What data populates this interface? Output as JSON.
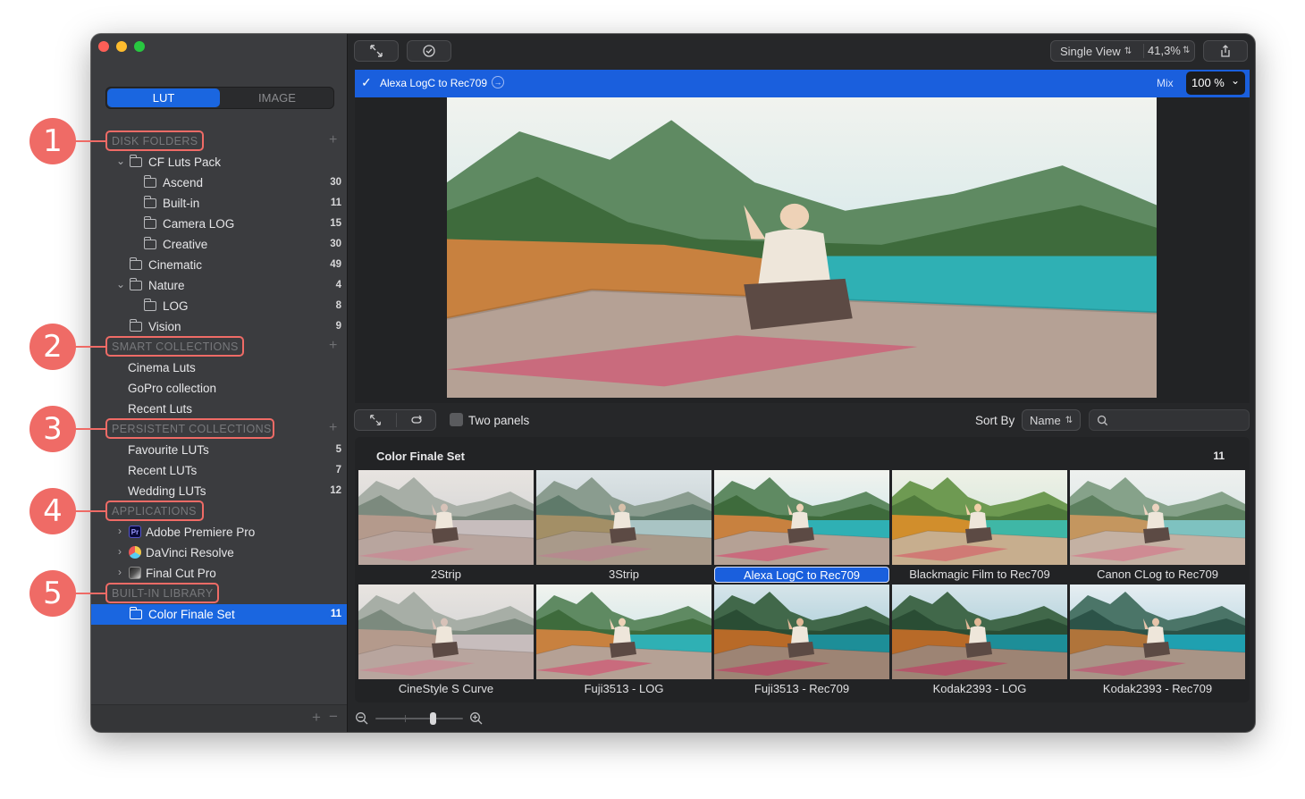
{
  "segmented": {
    "lut": "LUT",
    "image": "IMAGE"
  },
  "sections": {
    "disk_folders": "DISK FOLDERS",
    "smart_collections": "SMART COLLECTIONS",
    "persistent_collections": "PERSISTENT COLLECTIONS",
    "applications": "APPLICATIONS",
    "built_in_library": "BUILT-IN LIBRARY"
  },
  "disk_folders": [
    {
      "label": "CF Luts Pack",
      "count": ""
    },
    {
      "label": "Ascend",
      "count": "30"
    },
    {
      "label": "Built-in",
      "count": "11"
    },
    {
      "label": "Camera LOG",
      "count": "15"
    },
    {
      "label": "Creative",
      "count": "30"
    },
    {
      "label": "Cinematic",
      "count": "49"
    },
    {
      "label": "Nature",
      "count": "4"
    },
    {
      "label": "LOG",
      "count": "8"
    },
    {
      "label": "Vision",
      "count": "9"
    }
  ],
  "smart_collections": [
    {
      "label": "Cinema Luts"
    },
    {
      "label": "GoPro collection"
    },
    {
      "label": "Recent Luts"
    }
  ],
  "persistent_collections": [
    {
      "label": "Favourite LUTs",
      "count": "5"
    },
    {
      "label": "Recent LUTs",
      "count": "7"
    },
    {
      "label": "Wedding LUTs",
      "count": "12"
    }
  ],
  "applications": [
    {
      "label": "Adobe Premiere Pro",
      "icon_text": "Pr"
    },
    {
      "label": "DaVinci Resolve"
    },
    {
      "label": "Final Cut Pro"
    }
  ],
  "built_in_library": [
    {
      "label": "Color Finale Set",
      "count": "11"
    }
  ],
  "toolbar": {
    "view_mode": "Single View",
    "zoom": "41,3%"
  },
  "lut_bar": {
    "name": "Alexa LogC to Rec709",
    "mix_label": "Mix",
    "mix_value": "100 %"
  },
  "browser": {
    "two_panels_label": "Two panels",
    "sort_by_label": "Sort By",
    "sort_value": "Name",
    "search_placeholder": "",
    "group_title": "Color Finale Set",
    "group_count": "11",
    "thumbs": [
      {
        "label": "2Strip",
        "look": "faded"
      },
      {
        "label": "3Strip",
        "look": "muted"
      },
      {
        "label": "Alexa LogC to Rec709",
        "look": "teal",
        "selected": true
      },
      {
        "label": "Blackmagic Film to Rec709",
        "look": "warm"
      },
      {
        "label": "Canon CLog to Rec709",
        "look": "soft"
      },
      {
        "label": "CineStyle S Curve",
        "look": "faded"
      },
      {
        "label": "Fuji3513 - LOG",
        "look": "teal"
      },
      {
        "label": "Fuji3513 - Rec709",
        "look": "deep"
      },
      {
        "label": "Kodak2393 - LOG",
        "look": "deep"
      },
      {
        "label": "Kodak2393 - Rec709",
        "look": "cool"
      }
    ]
  },
  "annotations": [
    "1",
    "2",
    "3",
    "4",
    "5"
  ],
  "colors": {
    "accent": "#1a66e0",
    "annotation": "#ef6b66",
    "sidebar_bg": "#3b3c3f",
    "window_bg": "#262729"
  }
}
